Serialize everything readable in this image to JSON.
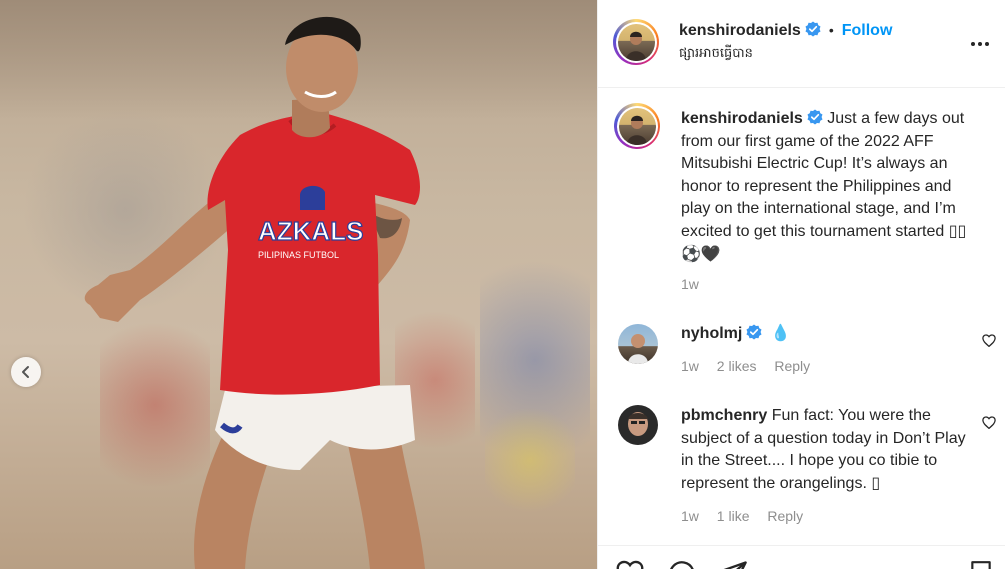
{
  "post": {
    "username": "kenshirodaniels",
    "follow_label": "Follow",
    "separator": "•",
    "location": "ផ្សារអាចធ្វើបាន",
    "more_label": "•••"
  },
  "caption": {
    "username": "kenshirodaniels",
    "text": "Just a few days out from our first game of the 2022 AFF Mitsubishi Electric Cup! It’s always an honor to represent the Philippines and play on the international stage, and I’m excited to get this tournament started ▯▯⚽🖤",
    "age": "1w"
  },
  "comments": [
    {
      "username": "nyholmj",
      "verified": true,
      "text": "💧",
      "age": "1w",
      "likes": "2 likes",
      "reply_label": "Reply"
    },
    {
      "username": "pbmchenry",
      "verified": false,
      "text": "Fun fact: You were the subject of a question today in Don’t Play in the Street.... I hope you co tibie to represent the orangelings. ▯",
      "age": "1w",
      "likes": "1 like",
      "reply_label": "Reply"
    }
  ],
  "photo": {
    "shirt_text": "AZKALS",
    "shirt_subtext": "PILIPINAS FUTBOL"
  },
  "icons": {
    "verified": "verified-badge-icon",
    "like": "heart-icon",
    "comment": "comment-icon",
    "share": "share-icon",
    "save": "bookmark-icon",
    "prev": "chevron-left-icon",
    "more": "more-horizontal-icon"
  },
  "colors": {
    "accent": "#0095f6",
    "verified": "#3897f0",
    "muted": "#8e8e8e",
    "shirt": "#d9262c"
  }
}
